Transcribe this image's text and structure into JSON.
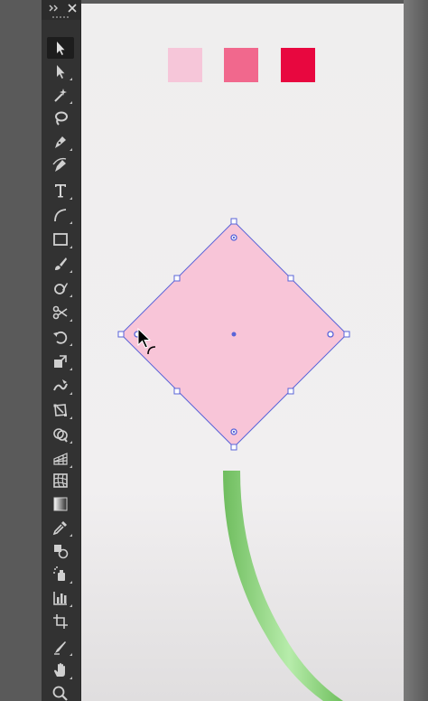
{
  "colors": {
    "swatch_light": "#f6c6d9",
    "swatch_medium": "#f1688d",
    "swatch_dark": "#e8073f",
    "shape_fill": "#f8c5d8",
    "selection_blue": "#5a64d8",
    "stem_green": "#82cc72",
    "panel_bg": "#323232",
    "icon_gray": "#d0d0d0"
  },
  "panel": {
    "collapse_icon": "double-chevron-icon",
    "close_icon": "close-icon"
  },
  "tools": [
    {
      "name": "selection-tool",
      "icon": "arrow-icon",
      "active": true
    },
    {
      "name": "direct-selection-tool",
      "icon": "white-arrow-icon"
    },
    {
      "name": "magic-wand-tool",
      "icon": "magic-wand-icon"
    },
    {
      "name": "lasso-tool",
      "icon": "lasso-icon"
    },
    {
      "name": "pen-tool",
      "icon": "pen-icon"
    },
    {
      "name": "curvature-tool",
      "icon": "curvature-pen-icon"
    },
    {
      "name": "type-tool",
      "icon": "type-icon",
      "glyph": "T"
    },
    {
      "name": "line-tool",
      "icon": "arc-line-icon"
    },
    {
      "name": "rectangle-tool",
      "icon": "rectangle-icon"
    },
    {
      "name": "paintbrush-tool",
      "icon": "brush-icon"
    },
    {
      "name": "shaper-tool",
      "icon": "shaper-icon"
    },
    {
      "name": "scissors-tool",
      "icon": "scissors-icon"
    },
    {
      "name": "rotate-tool",
      "icon": "rotate-icon"
    },
    {
      "name": "scale-tool",
      "icon": "scale-icon"
    },
    {
      "name": "warp-tool",
      "icon": "warp-icon"
    },
    {
      "name": "free-transform-tool",
      "icon": "free-transform-icon"
    },
    {
      "name": "shape-builder-tool",
      "icon": "shape-builder-icon"
    },
    {
      "name": "perspective-grid-tool",
      "icon": "perspective-grid-icon"
    },
    {
      "name": "mesh-tool",
      "icon": "mesh-icon"
    },
    {
      "name": "gradient-tool",
      "icon": "gradient-icon"
    },
    {
      "name": "eyedropper-tool",
      "icon": "eyedropper-icon"
    },
    {
      "name": "blend-tool",
      "icon": "blend-icon"
    },
    {
      "name": "symbol-sprayer-tool",
      "icon": "symbol-sprayer-icon"
    },
    {
      "name": "column-graph-tool",
      "icon": "column-graph-icon"
    },
    {
      "name": "artboard-tool",
      "icon": "artboard-icon"
    },
    {
      "name": "slice-tool",
      "icon": "slice-icon"
    },
    {
      "name": "hand-tool",
      "icon": "hand-icon"
    },
    {
      "name": "zoom-tool",
      "icon": "zoom-icon"
    }
  ],
  "canvas": {
    "swatches": [
      "swatch-light-pink",
      "swatch-medium-pink",
      "swatch-deep-pink"
    ],
    "selected_shape": "pink-diamond",
    "stem": "green-curved-stem"
  }
}
